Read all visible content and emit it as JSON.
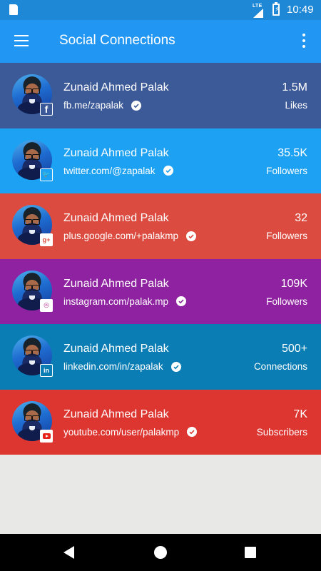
{
  "status_bar": {
    "network": "LTE",
    "time": "10:49"
  },
  "app_bar": {
    "title": "Social Connections",
    "menu_icon": "hamburger-menu-icon",
    "more_icon": "more-vert-icon"
  },
  "accounts": [
    {
      "network": "facebook",
      "badge_glyph": "f",
      "name": "Zunaid Ahmed Palak",
      "handle": "fb.me/zapalak",
      "count": "1.5M",
      "metric": "Likes",
      "color": "#3d5a98"
    },
    {
      "network": "twitter",
      "badge_glyph": "🐦",
      "name": "Zunaid Ahmed Palak",
      "handle": "twitter.com/@zapalak",
      "count": "35.5K",
      "metric": "Followers",
      "color": "#1da1f2"
    },
    {
      "network": "google-plus",
      "badge_glyph": "g+",
      "name": "Zunaid Ahmed Palak",
      "handle": "plus.google.com/+palakmp",
      "count": "32",
      "metric": "Followers",
      "color": "#db4b3f"
    },
    {
      "network": "instagram",
      "badge_glyph": "◎",
      "name": "Zunaid Ahmed Palak",
      "handle": "instagram.com/palak.mp",
      "count": "109K",
      "metric": "Followers",
      "color": "#8e22a0"
    },
    {
      "network": "linkedin",
      "badge_glyph": "in",
      "name": "Zunaid Ahmed Palak",
      "handle": "linkedin.com/in/zapalak",
      "count": "500+",
      "metric": "Connections",
      "color": "#0a7db4"
    },
    {
      "network": "youtube",
      "badge_glyph": "",
      "name": "Zunaid Ahmed Palak",
      "handle": "youtube.com/user/palakmp",
      "count": "7K",
      "metric": "Subscribers",
      "color": "#dd3530"
    }
  ],
  "colors": {
    "status_bar": "#1e87d6",
    "app_bar": "#2196f3",
    "background": "#e8e8e6"
  },
  "nav_bar": {
    "back_icon": "back-icon",
    "home_icon": "home-icon",
    "recents_icon": "recents-icon"
  }
}
